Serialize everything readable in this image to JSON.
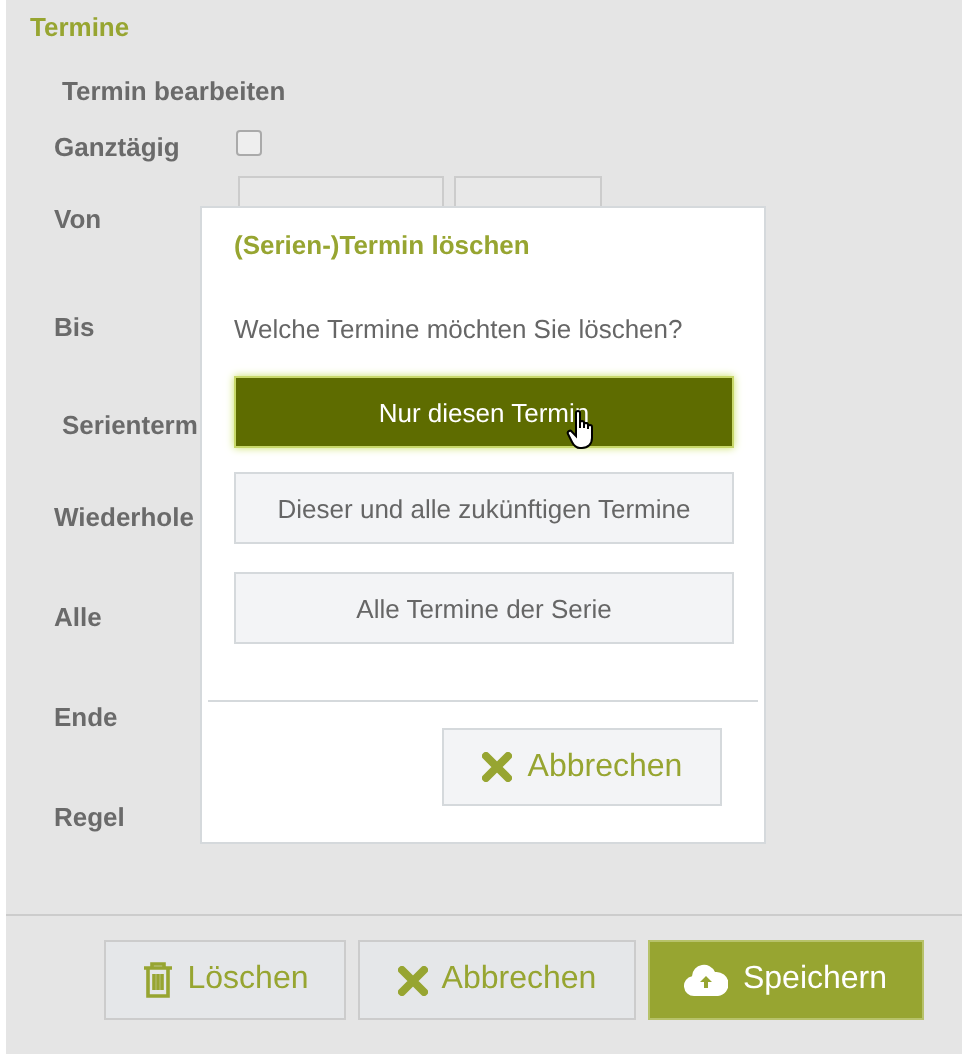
{
  "section_title": "Termine",
  "form": {
    "heading": "Termin bearbeiten",
    "rows": [
      {
        "kind": "checkbox",
        "label": "Ganztägig",
        "checked": false
      },
      {
        "kind": "datetime",
        "label": "Von"
      },
      {
        "kind": "plain",
        "label": "Bis"
      },
      {
        "kind": "heading",
        "label": "Serienterm"
      },
      {
        "kind": "plain",
        "label": "Wiederhole"
      },
      {
        "kind": "plain",
        "label": "Alle"
      },
      {
        "kind": "plain",
        "label": "Ende"
      },
      {
        "kind": "plain",
        "label": "Regel"
      }
    ]
  },
  "footer_buttons": [
    {
      "kind": "delete",
      "label": "Löschen"
    },
    {
      "kind": "cancel",
      "label": "Abbrechen"
    },
    {
      "kind": "save",
      "label": "Speichern"
    }
  ],
  "dialog": {
    "title": "(Serien-)Termin löschen",
    "question": "Welche Termine möchten Sie löschen?",
    "options": [
      {
        "label": "Nur diesen Termin",
        "selected": true
      },
      {
        "label": "Dieser und alle zukünftigen Termine",
        "selected": false
      },
      {
        "label": "Alle Termine der Serie",
        "selected": false
      }
    ],
    "cancel": {
      "label": "Abbrechen"
    }
  }
}
